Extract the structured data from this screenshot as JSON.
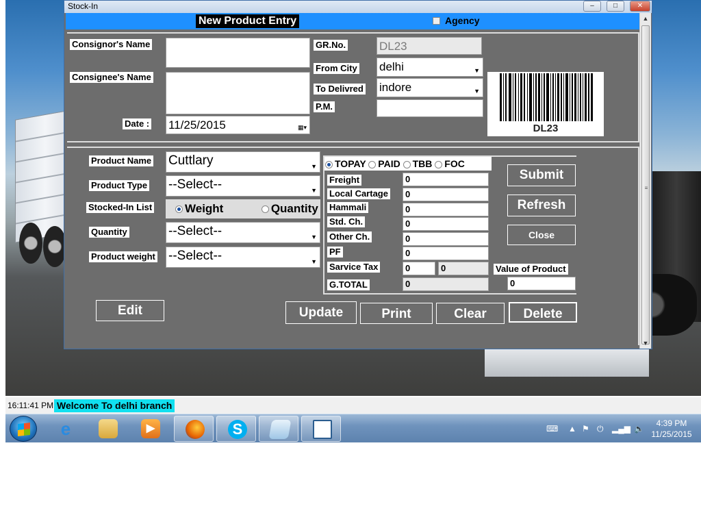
{
  "window": {
    "title": "Stock-In",
    "min": "–",
    "max": "□",
    "close": "✕"
  },
  "header": {
    "heading": "New Product Entry",
    "agency_label": "Agency",
    "agency_checked": false
  },
  "top": {
    "consignor_label": "Consignor's Name",
    "consignor_value": "",
    "consignee_label": "Consignee's Name",
    "consignee_value": "",
    "date_label": "Date :",
    "date_value": "11/25/2015",
    "grno_label": "GR.No.",
    "grno_value": "DL23",
    "from_city_label": "From City",
    "from_city_value": "delhi",
    "to_label": "To Delivred",
    "to_value": "indore",
    "pm_label": "P.M.",
    "pm_value": "",
    "barcode_text": "DL23"
  },
  "product": {
    "name_label": "Product Name",
    "name_value": "Cuttlary",
    "type_label": "Product Type",
    "type_value": "--Select--",
    "stocked_label": "Stocked-In List",
    "weight_option": "Weight",
    "quantity_option": "Quantity",
    "selected": "Weight",
    "quantity_label": "Quantity",
    "quantity_value": "--Select--",
    "weight_label": "Product weight",
    "weight_value": "--Select--"
  },
  "payment": {
    "options": [
      "TOPAY",
      "PAID",
      "TBB",
      "FOC"
    ],
    "selected": "TOPAY",
    "freight_label": "Freight",
    "freight": "0",
    "local_label": "Local Cartage",
    "local": "0",
    "hammali_label": "Hammali",
    "hammali": "0",
    "std_label": "Std. Ch.",
    "std": "0",
    "other_label": "Other Ch.",
    "other": "0",
    "pf_label": "PF",
    "pf": "0",
    "tax_label": "Sarvice Tax",
    "tax_rate": "0",
    "tax_amount": "0",
    "gtotal_label": "G.TOTAL",
    "gtotal": "0",
    "value_label": "Value of Product",
    "value": "0"
  },
  "buttons": {
    "submit": "Submit",
    "refresh": "Refresh",
    "close": "Close",
    "edit": "Edit",
    "update": "Update",
    "print": "Print",
    "clear": "Clear",
    "delete": "Delete"
  },
  "status": {
    "clock": "16:11:41 PM",
    "welcome": "Welcome To delhi branch"
  },
  "taskbar": {
    "apps": [
      "ie-icon",
      "explorer-icon",
      "media-player-icon",
      "firefox-icon",
      "skype-icon",
      "notepad-icon",
      "app-window-icon"
    ],
    "time": "4:39 PM",
    "date": "11/25/2015"
  }
}
